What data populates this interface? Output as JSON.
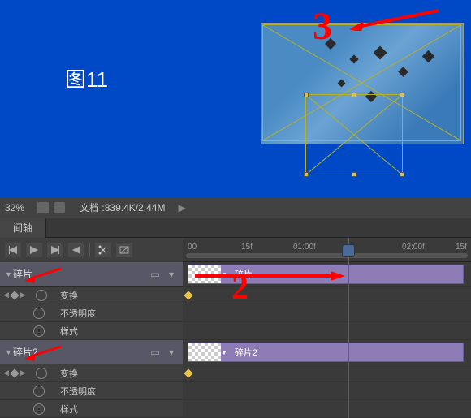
{
  "canvas": {
    "label": "图11",
    "annotation_number": "3"
  },
  "status": {
    "zoom": "32%",
    "doc_label": "文档",
    "doc_size": "839.4K/2.44M"
  },
  "tab": {
    "title": "间轴"
  },
  "ruler": {
    "ticks": [
      "00",
      "15f",
      "01:00f",
      "02:00f",
      "15f"
    ]
  },
  "layers": [
    {
      "name": "碎片",
      "clip_label": "碎片",
      "props": [
        {
          "label": "变换",
          "has_keys": true
        },
        {
          "label": "不透明度",
          "has_keys": false
        },
        {
          "label": "样式",
          "has_keys": false
        }
      ]
    },
    {
      "name": "碎片2",
      "clip_label": "碎片2",
      "props": [
        {
          "label": "变换",
          "has_keys": true
        },
        {
          "label": "不透明度",
          "has_keys": false
        },
        {
          "label": "样式",
          "has_keys": false
        }
      ]
    }
  ],
  "annotation2": "2"
}
